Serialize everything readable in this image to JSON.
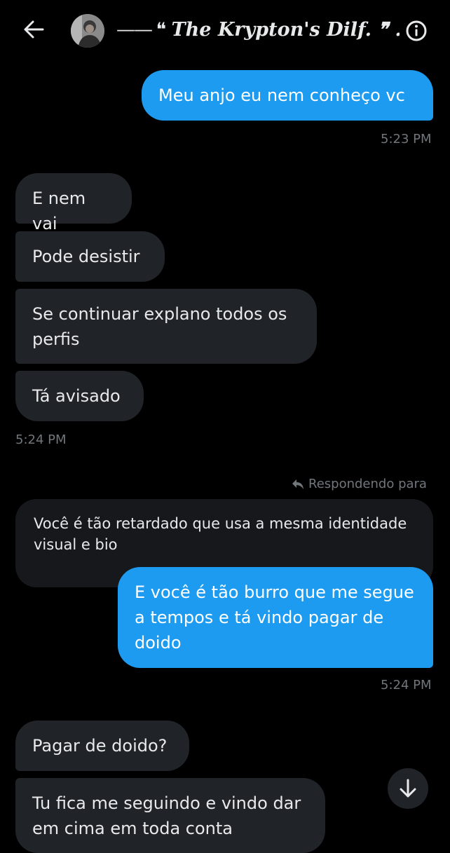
{
  "header": {
    "title_prefix": "—— ❝",
    "title": "The Krypton's Dilf. ❞ ...",
    "icons": {
      "back": "arrow-left-icon",
      "info": "info-circle-icon"
    }
  },
  "messages": {
    "m1": "Meu anjo  eu nem conheço vc",
    "t1": "5:23 PM",
    "m2": "E nem vai",
    "m3": "Pode desistir",
    "m4": "Se continuar explano todos os perfis",
    "m5": "Tá avisado",
    "t2": "5:24 PM",
    "reply_label": "Respondendo para",
    "quoted": "Você é tão retardado que usa a mesma identidade visual e bio",
    "m6": "E você é tão burro que me segue a tempos e tá vindo pagar de doido",
    "t3": "5:24 PM",
    "m7": "Pagar de doido?",
    "m8": "Tu fica me seguindo e vindo dar em cima em toda conta"
  },
  "colors": {
    "background": "#000000",
    "outgoing_bubble": "#1d9bf0",
    "incoming_bubble": "#202327",
    "muted_text": "#71767b"
  }
}
